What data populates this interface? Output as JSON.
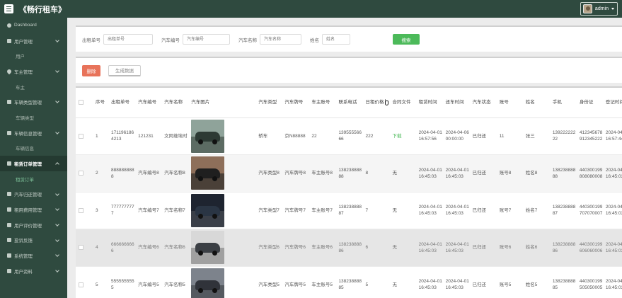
{
  "header": {
    "title": "《畅行租车》",
    "username": "admin"
  },
  "sidebar": {
    "items": [
      {
        "label": "Dashboard",
        "type": "top"
      },
      {
        "label": "用户管理",
        "type": "group",
        "arrow": "down"
      },
      {
        "label": "用户",
        "type": "sub"
      },
      {
        "label": "车主管理",
        "type": "group",
        "arrow": "down"
      },
      {
        "label": "车主",
        "type": "sub"
      },
      {
        "label": "车辆类型管理",
        "type": "group",
        "arrow": "down"
      },
      {
        "label": "车辆类型",
        "type": "sub"
      },
      {
        "label": "车辆信息管理",
        "type": "group",
        "arrow": "down"
      },
      {
        "label": "车辆信息",
        "type": "sub"
      },
      {
        "label": "租赁订单管理",
        "type": "group",
        "arrow": "up",
        "active": true
      },
      {
        "label": "租赁订单",
        "type": "sub",
        "active": true
      },
      {
        "label": "汽车归还管理",
        "type": "group",
        "arrow": "down"
      },
      {
        "label": "租用费用管理",
        "type": "group",
        "arrow": "down"
      },
      {
        "label": "用户评价管理",
        "type": "group",
        "arrow": "down"
      },
      {
        "label": "投诉反馈",
        "type": "group",
        "arrow": "down"
      },
      {
        "label": "系统管理",
        "type": "group",
        "arrow": "down"
      },
      {
        "label": "用户资料",
        "type": "group",
        "arrow": "down"
      }
    ]
  },
  "search": {
    "fields": [
      {
        "label": "出租单号",
        "placeholder": "出租单号"
      },
      {
        "label": "汽车编号",
        "placeholder": "汽车编号"
      },
      {
        "label": "汽车名称",
        "placeholder": "汽车名称"
      },
      {
        "label": "姓名",
        "placeholder": "姓名"
      }
    ],
    "button_label": "搜索"
  },
  "actions": {
    "delete_label": "删除",
    "generate_label": "生成数据"
  },
  "table": {
    "headers": [
      "",
      "序号",
      "出租单号",
      "汽车编号",
      "汽车名称",
      "汽车图片",
      "汽车类型",
      "汽车牌号",
      "车主账号",
      "联系电话",
      "日租价格",
      "合同文件",
      "租赁时间",
      "还车时间",
      "汽车状态",
      "账号",
      "姓名",
      "手机",
      "身份证",
      "登记时间"
    ],
    "rows": [
      {
        "index": "1",
        "order_no": "1711961864213",
        "car_no": "121231",
        "car_name": "文阿维埃时",
        "car_type": "轿车",
        "plate": "京N88888",
        "owner": "22",
        "phone": "13955556666",
        "price": "222",
        "contract": "下载",
        "rent_time": "2024-04-01 16:57:56",
        "return_time": "2024-04-06 00:00:00",
        "status": "已归还",
        "account": "11",
        "name": "张三",
        "mobile": "13922222222",
        "id_card": "412345678912345222",
        "reg_time": "2024-04-01 16:57:44",
        "car_color": "#2d3a34",
        "sky": "#8fa39a",
        "road": "#5c6b63"
      },
      {
        "index": "2",
        "order_no": "8888888888",
        "car_no": "汽车编号8",
        "car_name": "汽车名称8",
        "car_type": "汽车类型8",
        "plate": "汽车牌号8",
        "owner": "车主账号8",
        "phone": "13823888888",
        "price": "8",
        "contract": "无",
        "rent_time": "2024-04-01 16:45:03",
        "return_time": "2024-04-01 16:45:03",
        "status": "已归还",
        "account": "账号8",
        "name": "姓名8",
        "mobile": "13823888888",
        "id_card": "440300199808080008",
        "reg_time": "2024-04-01 16:45:03",
        "car_color": "#1f1f1f",
        "sky": "#8e6f5a",
        "road": "#4a4038"
      },
      {
        "index": "3",
        "order_no": "7777777777",
        "car_no": "汽车编号7",
        "car_name": "汽车名称7",
        "car_type": "汽车类型7",
        "plate": "汽车牌号7",
        "owner": "车主账号7",
        "phone": "13823888887",
        "price": "7",
        "contract": "无",
        "rent_time": "2024-04-01 16:45:03",
        "return_time": "2024-04-01 16:45:03",
        "status": "已归还",
        "account": "账号7",
        "name": "姓名7",
        "mobile": "13823888887",
        "id_card": "440300199707070007",
        "reg_time": "2024-04-01 16:45:03",
        "car_color": "#2a3544",
        "sky": "#1e2430",
        "road": "#3a3f48"
      },
      {
        "index": "4",
        "order_no": "6666666666",
        "car_no": "汽车编号6",
        "car_name": "汽车名称6",
        "car_type": "汽车类型6",
        "plate": "汽车牌号6",
        "owner": "车主账号6",
        "phone": "13823888886",
        "price": "6",
        "contract": "无",
        "rent_time": "2024-04-01 16:45:03",
        "return_time": "2024-04-01 16:45:03",
        "status": "已归还",
        "account": "账号6",
        "name": "姓名6",
        "mobile": "13823888886",
        "id_card": "440300199606060006",
        "reg_time": "2024-04-01 16:45:03",
        "car_color": "#3b3f44",
        "sky": "#d8d8d8",
        "road": "#a0a0a0"
      },
      {
        "index": "5",
        "order_no": "5555555555",
        "car_no": "汽车编号5",
        "car_name": "汽车名称5",
        "car_type": "汽车类型5",
        "plate": "汽车牌号5",
        "owner": "车主账号5",
        "phone": "13823888885",
        "price": "5",
        "contract": "无",
        "rent_time": "2024-04-01 16:45:03",
        "return_time": "2024-04-01 16:45:03",
        "status": "已归还",
        "account": "账号5",
        "name": "姓名5",
        "mobile": "13823888885",
        "id_card": "440300199505050005",
        "reg_time": "2024-04-01 16:45:03",
        "car_color": "#30333a",
        "sky": "#7d838c",
        "road": "#555a60"
      }
    ]
  }
}
